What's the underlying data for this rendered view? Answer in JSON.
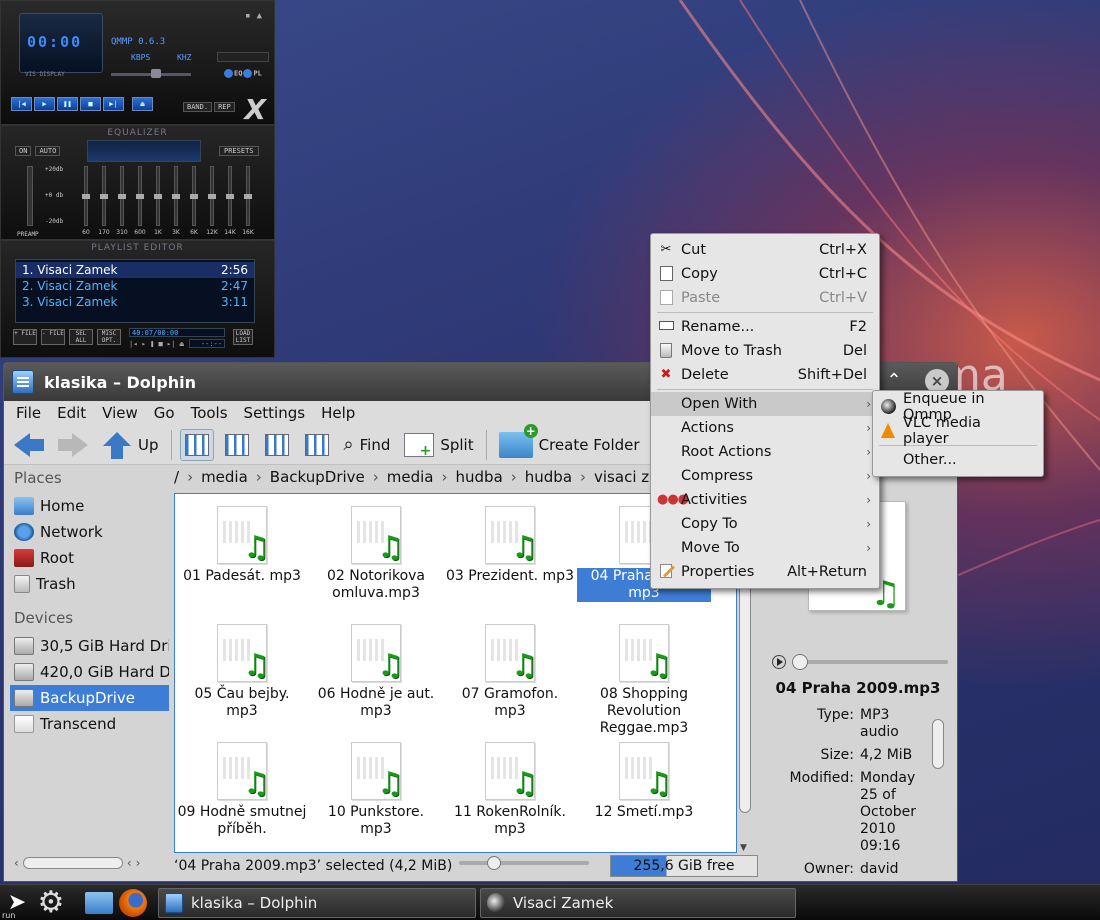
{
  "qmmp": {
    "time": "00:00",
    "title": "QMMP 0.6.3",
    "kbps": "KBPS",
    "khz": "KHZ",
    "vis_label": "VIS DISPLAY",
    "eq_label": "EQ",
    "pl_label": "PL",
    "band_label": "BAND.",
    "rep_label": "REP",
    "equalizer_title": "EQUALIZER",
    "on_label": "ON",
    "auto_label": "AUTO",
    "presets_label": "PRESETS",
    "db_top": "+20db",
    "db_mid": "+0 db",
    "db_bottom": "-20db",
    "preamp_label": "PREAMP",
    "bands": [
      "60",
      "170",
      "310",
      "600",
      "1K",
      "3K",
      "6K",
      "12K",
      "14K",
      "16K"
    ],
    "playlist_title": "PLAYLIST EDITOR",
    "playlist": [
      {
        "title": "1. Visaci Zamek",
        "time": "2:56"
      },
      {
        "title": "2. Visaci Zamek",
        "time": "2:47"
      },
      {
        "title": "3. Visaci Zamek",
        "time": "3:11"
      }
    ],
    "pl_buttons": [
      "+ FILE",
      "- FILE",
      "SEL ALL",
      "MISC OPT."
    ],
    "pl_time": "40:07/00:00",
    "pl_time2": "--:--",
    "load_list": "LOAD LIST"
  },
  "dolphin": {
    "title": "klasika – Dolphin",
    "menu": [
      "File",
      "Edit",
      "View",
      "Go",
      "Tools",
      "Settings",
      "Help"
    ],
    "toolbar": {
      "up": "Up",
      "find": "Find",
      "split": "Split",
      "create_folder": "Create Folder"
    },
    "places_header": "Places",
    "places": [
      "Home",
      "Network",
      "Root",
      "Trash"
    ],
    "devices_header": "Devices",
    "devices": [
      "30,5 GiB Hard Drive",
      "420,0 GiB Hard Drive",
      "BackupDrive",
      "Transcend"
    ],
    "breadcrumb": [
      "/",
      "media",
      "BackupDrive",
      "media",
      "hudba",
      "hudba",
      "visaci zamek"
    ],
    "files": [
      {
        "name": "01 Padesát. mp3"
      },
      {
        "name": "02 Notorikova omluva.mp3"
      },
      {
        "name": "03 Prezident. mp3"
      },
      {
        "name": "04 Praha 2009. mp3",
        "selected": true
      },
      {
        "name": "05 Čau bejby. mp3"
      },
      {
        "name": "06 Hodně je aut. mp3"
      },
      {
        "name": "07 Gramofon. mp3"
      },
      {
        "name": "08 Shopping Revolution Reggae.mp3"
      },
      {
        "name": "09 Hodně smutnej příběh."
      },
      {
        "name": "10 Punkstore. mp3"
      },
      {
        "name": "11 RokenRolník. mp3"
      },
      {
        "name": "12 Smetí.mp3"
      }
    ],
    "status": "‘04 Praha 2009.mp3’ selected (4,2 MiB)",
    "free_space": "255,6 GiB free",
    "free_fraction": 0.38,
    "info": {
      "name": "04 Praha 2009.mp3",
      "meta": [
        {
          "k": "Type:",
          "v": "MP3 audio"
        },
        {
          "k": "Size:",
          "v": "4,2 MiB"
        },
        {
          "k": "Modified:",
          "v": "Monday 25 of October 2010 09:16"
        },
        {
          "k": "Owner:",
          "v": "david"
        }
      ]
    }
  },
  "context_menu": {
    "items": [
      {
        "label": "Cut",
        "shortcut": "Ctrl+X",
        "icon": "scissors-icon"
      },
      {
        "label": "Copy",
        "shortcut": "Ctrl+C",
        "icon": "copy-icon"
      },
      {
        "label": "Paste",
        "shortcut": "Ctrl+V",
        "icon": "paste-icon",
        "disabled": true
      },
      {
        "label": "Rename...",
        "shortcut": "F2",
        "icon": "rename-icon"
      },
      {
        "label": "Move to Trash",
        "shortcut": "Del",
        "icon": "trash-icon"
      },
      {
        "label": "Delete",
        "shortcut": "Shift+Del",
        "icon": "delete-icon"
      },
      {
        "label": "Open With",
        "submenu": true,
        "highlighted": true
      },
      {
        "label": "Actions",
        "submenu": true
      },
      {
        "label": "Root Actions",
        "submenu": true
      },
      {
        "label": "Compress",
        "submenu": true
      },
      {
        "label": "Activities",
        "submenu": true,
        "icon": "activities-icon"
      },
      {
        "label": "Copy To",
        "submenu": true
      },
      {
        "label": "Move To",
        "submenu": true
      },
      {
        "label": "Properties",
        "shortcut": "Alt+Return",
        "icon": "properties-icon"
      }
    ],
    "open_with": [
      {
        "label": "Enqueue in Qmmp",
        "icon": "qmmp-icon"
      },
      {
        "label": "VLC media player",
        "icon": "vlc-icon"
      },
      {
        "label": "Other..."
      }
    ]
  },
  "taskbar": {
    "run_label": "run",
    "tasks": [
      "klasika – Dolphin",
      "Visaci Zamek"
    ]
  },
  "colors": {
    "selection": "#3d7dd5",
    "music_note": "#1a9a1a"
  }
}
